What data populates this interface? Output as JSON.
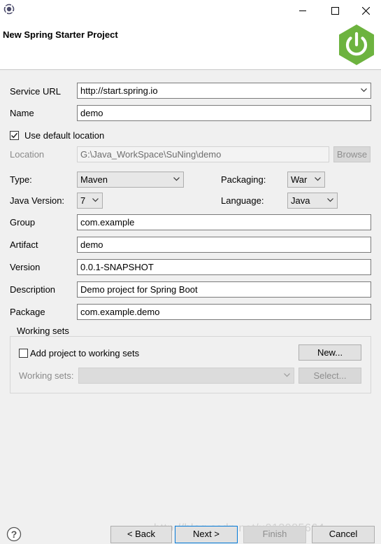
{
  "window": {
    "title": "New Spring Starter Project"
  },
  "form": {
    "service_url": {
      "label": "Service URL",
      "value": "http://start.spring.io"
    },
    "name": {
      "label": "Name",
      "value": "demo"
    },
    "use_default_location": {
      "label": "Use default location",
      "checked": true
    },
    "location": {
      "label": "Location",
      "value": "G:\\Java_WorkSpace\\SuNing\\demo",
      "browse_label": "Browse"
    },
    "type": {
      "label": "Type:",
      "value": "Maven"
    },
    "packaging": {
      "label": "Packaging:",
      "value": "War"
    },
    "java_version": {
      "label": "Java Version:",
      "value": "7"
    },
    "language": {
      "label": "Language:",
      "value": "Java"
    },
    "group": {
      "label": "Group",
      "value": "com.example"
    },
    "artifact": {
      "label": "Artifact",
      "value": "demo"
    },
    "version": {
      "label": "Version",
      "value": "0.0.1-SNAPSHOT"
    },
    "description": {
      "label": "Description",
      "value": "Demo project for Spring Boot"
    },
    "package": {
      "label": "Package",
      "value": "com.example.demo"
    }
  },
  "working_sets": {
    "group_label": "Working sets",
    "add_label": "Add project to working sets",
    "add_checked": false,
    "new_button": "New...",
    "sets_label": "Working sets:",
    "sets_value": "",
    "select_button": "Select..."
  },
  "footer": {
    "help_glyph": "?",
    "back": "< Back",
    "next": "Next >",
    "finish": "Finish",
    "cancel": "Cancel",
    "watermark": "http://blog.csdn.net/u013985664"
  },
  "colors": {
    "spring_green": "#6db33f",
    "focus_blue": "#0078d7"
  },
  "icons": {
    "app": "eclipse-icon",
    "minimize": "minimize-icon",
    "maximize": "maximize-icon",
    "close": "close-icon",
    "logo": "spring-power-logo",
    "help": "help-icon",
    "dropdown": "chevron-down-icon",
    "check": "checkmark-icon"
  }
}
